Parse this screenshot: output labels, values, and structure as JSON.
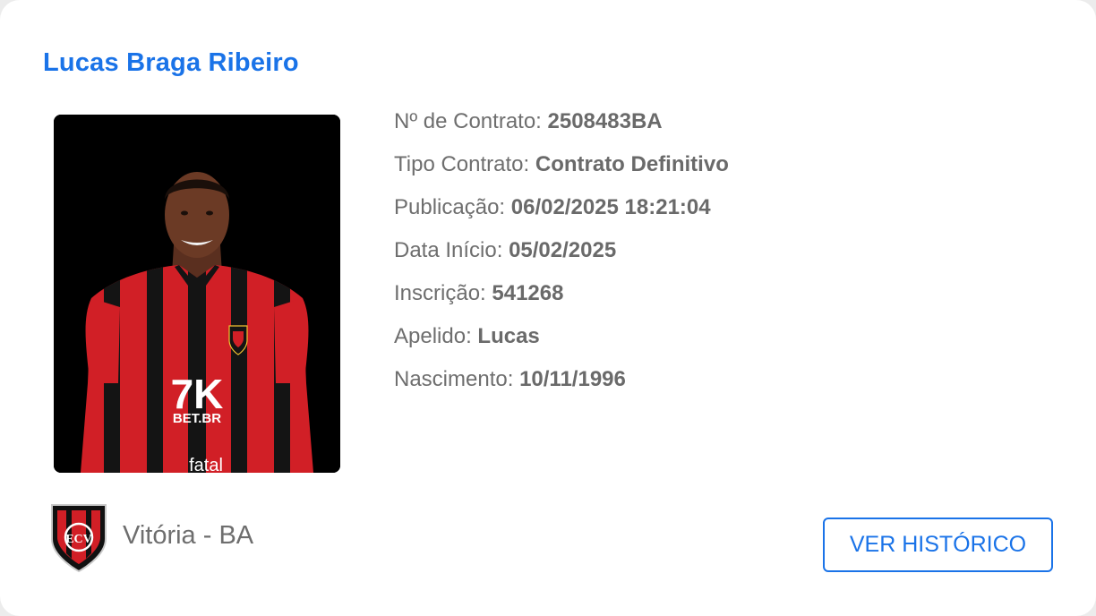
{
  "player": {
    "name": "Lucas Braga Ribeiro"
  },
  "photo": {
    "shirt_sponsor": "7K",
    "shirt_sponsor_sub": "BET.BR",
    "shirt_bottom_sponsor": "fatal"
  },
  "details": [
    {
      "label": "Nº de Contrato: ",
      "value": "2508483BA"
    },
    {
      "label": "Tipo Contrato: ",
      "value": "Contrato Definitivo"
    },
    {
      "label": "Publicação: ",
      "value": "06/02/2025 18:21:04"
    },
    {
      "label": "Data Início: ",
      "value": "05/02/2025"
    },
    {
      "label": "Inscrição: ",
      "value": "541268"
    },
    {
      "label": "Apelido: ",
      "value": "Lucas"
    },
    {
      "label": "Nascimento: ",
      "value": "10/11/1996"
    }
  ],
  "club": {
    "name": "Vitória - BA",
    "crest_icon": "club-crest-icon",
    "crest_letters": "ECV"
  },
  "actions": {
    "history_label": "VER HISTÓRICO"
  },
  "colors": {
    "accent": "#1a73e8",
    "text_muted": "#6e6e6e",
    "club_red": "#d11f26",
    "club_black": "#111111"
  }
}
